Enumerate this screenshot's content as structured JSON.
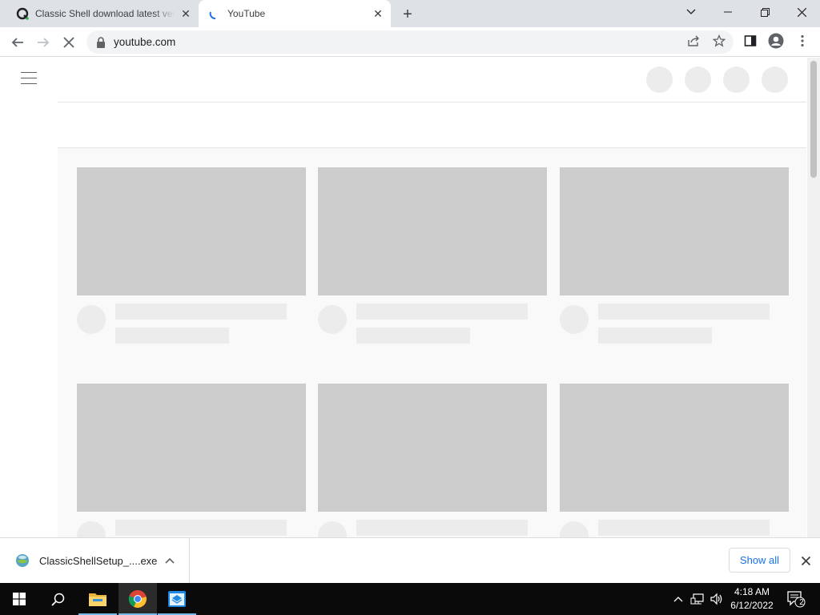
{
  "browser": {
    "tabs": [
      {
        "title": "Classic Shell download latest version",
        "close": "✕",
        "favicon": "quora-q-icon"
      },
      {
        "title": "YouTube",
        "close": "✕",
        "favicon": "loading-spinner-icon"
      }
    ],
    "new_tab": "+",
    "window_controls": {
      "tab_search": "⌄",
      "minimize": "—",
      "restore": "❐",
      "close": "✕"
    },
    "url": "youtube.com",
    "toolbar_icons": [
      "back-icon",
      "forward-icon",
      "stop-loading-icon",
      "lock-icon",
      "share-icon",
      "bookmark-star-icon",
      "side-panel-icon",
      "profile-icon",
      "menu-kebab-icon"
    ]
  },
  "download_shelf": {
    "filename": "ClassicShellSetup_....exe",
    "show_all": "Show all",
    "chevron": "⌃",
    "close": "✕"
  },
  "taskbar": {
    "time": "4:18 AM",
    "date": "6/12/2022",
    "notification_count": "2",
    "apps": [
      "start-icon",
      "search-icon",
      "file-explorer-icon",
      "chrome-icon",
      "store-app-icon"
    ]
  },
  "colors": {
    "tabstrip": "#dee1e6",
    "skeleton_thumb": "#cccccc",
    "skeleton_line": "#ececec",
    "link_blue": "#1a73e8",
    "taskbar": "#0a0a0a"
  }
}
